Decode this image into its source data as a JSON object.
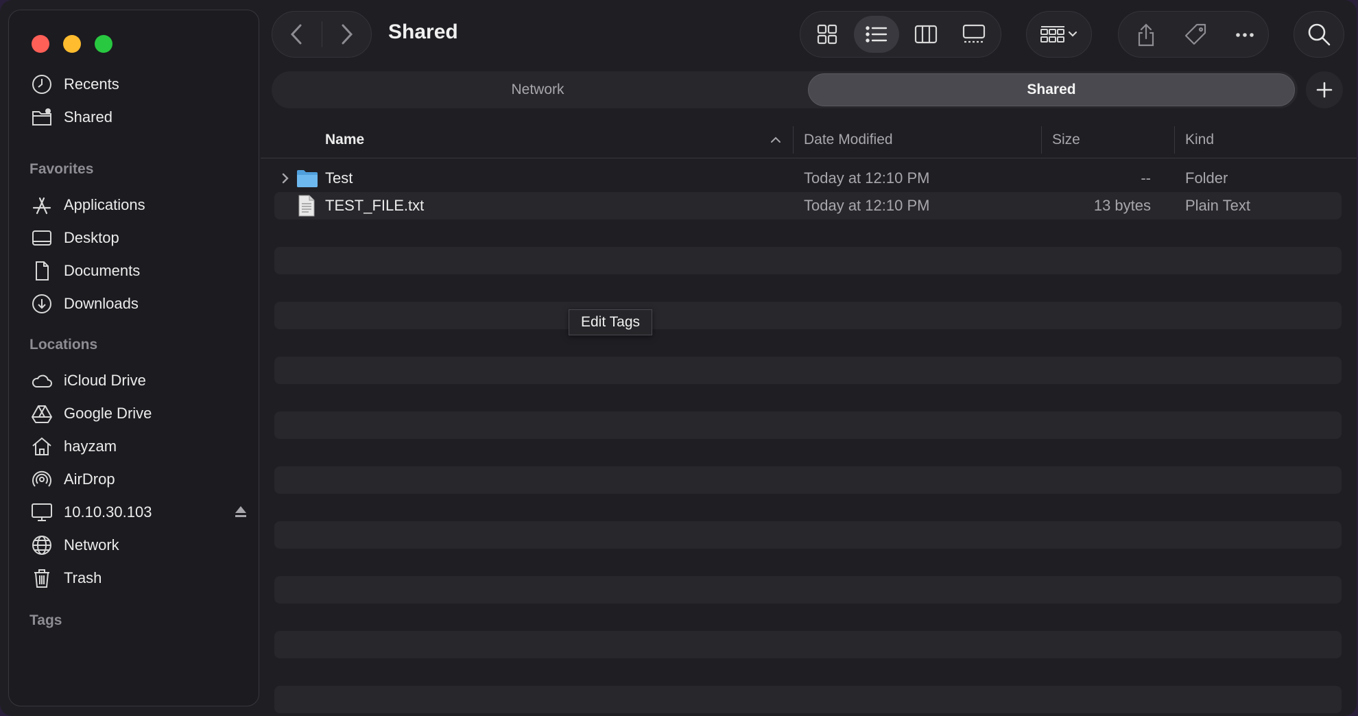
{
  "window": {
    "title": "Shared"
  },
  "sidebar": {
    "top_items": [
      {
        "label": "Recents",
        "icon": "clock-icon"
      },
      {
        "label": "Shared",
        "icon": "shared-folder-icon"
      }
    ],
    "favorites_label": "Favorites",
    "favorites": [
      {
        "label": "Applications",
        "icon": "applications-icon"
      },
      {
        "label": "Desktop",
        "icon": "desktop-icon"
      },
      {
        "label": "Documents",
        "icon": "document-icon"
      },
      {
        "label": "Downloads",
        "icon": "download-icon"
      }
    ],
    "locations_label": "Locations",
    "locations": [
      {
        "label": "iCloud Drive",
        "icon": "cloud-icon"
      },
      {
        "label": "Google Drive",
        "icon": "google-drive-icon"
      },
      {
        "label": "hayzam",
        "icon": "home-icon"
      },
      {
        "label": "AirDrop",
        "icon": "airdrop-icon"
      },
      {
        "label": "10.10.30.103",
        "icon": "monitor-icon",
        "eject": true
      },
      {
        "label": "Network",
        "icon": "globe-icon"
      },
      {
        "label": "Trash",
        "icon": "trash-icon"
      }
    ],
    "tags_label": "Tags"
  },
  "tabs": [
    {
      "label": "Network",
      "active": false
    },
    {
      "label": "Shared",
      "active": true
    }
  ],
  "columns": {
    "name": "Name",
    "date": "Date Modified",
    "size": "Size",
    "kind": "Kind"
  },
  "files": [
    {
      "name": "Test",
      "date": "Today at 12:10 PM",
      "size": "--",
      "kind": "Folder",
      "icon": "folder-icon"
    },
    {
      "name": "TEST_FILE.txt",
      "date": "Today at 12:10 PM",
      "size": "13 bytes",
      "kind": "Plain Text",
      "icon": "text-file-icon"
    }
  ],
  "tooltip": {
    "text": "Edit Tags"
  },
  "colors": {
    "close": "#fe5f57",
    "minimize": "#febc2e",
    "zoom": "#28c840",
    "folder": "#5aa9e6"
  }
}
